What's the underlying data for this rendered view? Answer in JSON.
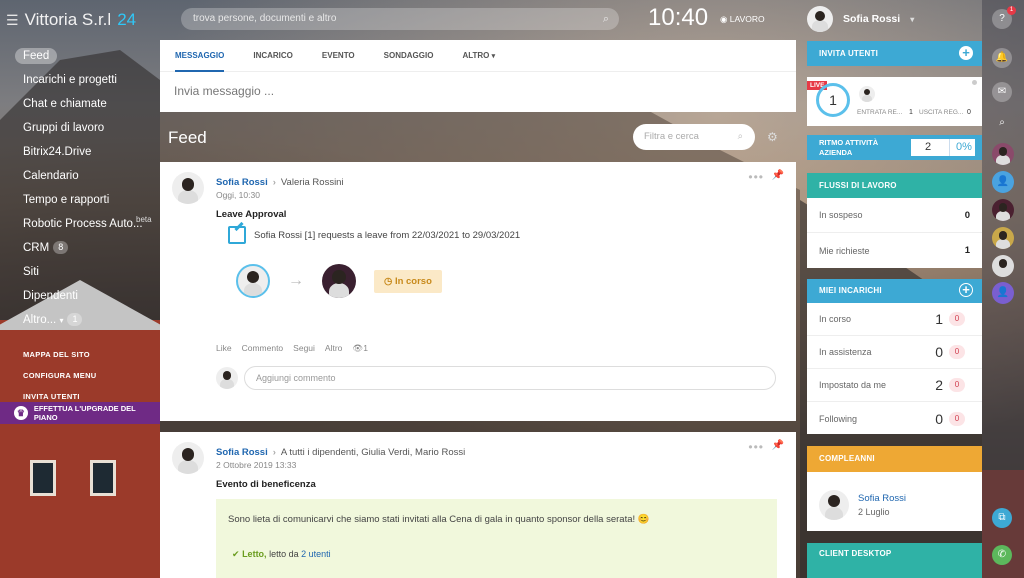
{
  "app": {
    "name": "Vittoria S.r.l",
    "name_suffix": "24"
  },
  "left_menu": {
    "items": [
      {
        "label": "Feed",
        "active": true
      },
      {
        "label": "Incarichi e progetti"
      },
      {
        "label": "Chat e chiamate"
      },
      {
        "label": "Gruppi di lavoro"
      },
      {
        "label": "Bitrix24.Drive"
      },
      {
        "label": "Calendario"
      },
      {
        "label": "Tempo e rapporti"
      },
      {
        "label": "Robotic Process Auto...",
        "tag": "beta"
      },
      {
        "label": "CRM",
        "badge": "8"
      },
      {
        "label": "Siti"
      },
      {
        "label": "Dipendenti"
      },
      {
        "label": "Altro...",
        "badge": "1"
      }
    ],
    "sub_items": [
      "MAPPA DEL SITO",
      "CONFIGURA MENU",
      "INVITA UTENTI"
    ],
    "upgrade": "EFFETTUA L'UPGRADE DEL PIANO"
  },
  "topbar": {
    "search_placeholder": "trova persone, documenti e altro",
    "time": "10:40",
    "work_label": "LAVORO",
    "user_name": "Sofia Rossi"
  },
  "composer": {
    "tabs": [
      "MESSAGGIO",
      "INCARICO",
      "EVENTO",
      "SONDAGGIO",
      "ALTRO"
    ],
    "active_tab": "MESSAGGIO",
    "placeholder": "Invia messaggio ..."
  },
  "feed": {
    "title": "Feed",
    "filter_placeholder": "Filtra e cerca",
    "posts": [
      {
        "author": "Sofia Rossi",
        "to": "Valeria Rossini",
        "date": "Oggi, 10:30",
        "title": "Leave Approval",
        "request": "Sofia Rossi [1] requests a leave from 22/03/2021 to 29/03/2021",
        "status": "In corso",
        "actions": [
          "Like",
          "Commento",
          "Segui",
          "Altro"
        ],
        "views": "1",
        "comment_placeholder": "Aggiungi commento"
      },
      {
        "author": "Sofia Rossi",
        "to": "A tutti i dipendenti, Giulia Verdi, Mario Rossi",
        "date": "2 Ottobre 2019 13:33",
        "title": "Evento di beneficenza",
        "body": "Sono lieta di comunicarvi che siamo stati invitati alla Cena di gala in quanto sponsor della serata! 😊",
        "read_label": "Letto,",
        "read_by": "letto da",
        "read_link": "2 utenti"
      }
    ]
  },
  "right": {
    "invite": "INVITA UTENTI",
    "live": {
      "badge": "LIVE",
      "count": "1",
      "in_label": "ENTRATA RE...",
      "in_val": "1",
      "out_label": "USCITA REG...",
      "out_val": "0"
    },
    "ritmo": {
      "label": "RITMO ATTIVITÀ AZIENDA",
      "value": "2",
      "pct": "0%"
    },
    "flussi": {
      "title": "FLUSSI DI LAVORO",
      "rows": [
        {
          "label": "In sospeso",
          "value": "0"
        },
        {
          "label": "Mie richieste",
          "value": "1"
        }
      ]
    },
    "incarichi": {
      "title": "MIEI INCARICHI",
      "rows": [
        {
          "label": "In corso",
          "value": "1",
          "badge": "0"
        },
        {
          "label": "In assistenza",
          "value": "0",
          "badge": "0"
        },
        {
          "label": "Impostato da me",
          "value": "2",
          "badge": "0"
        },
        {
          "label": "Following",
          "value": "0",
          "badge": "0"
        }
      ]
    },
    "compleanni": {
      "title": "COMPLEANNI",
      "name": "Sofia Rossi",
      "date": "2 Luglio"
    },
    "client": "CLIENT DESKTOP"
  },
  "colors": {
    "accent": "#2067b0",
    "blue_header": "#3da9d4",
    "teal_header": "#2fb2a6",
    "orange_header": "#eea834",
    "upgrade": "#6f2a85"
  }
}
